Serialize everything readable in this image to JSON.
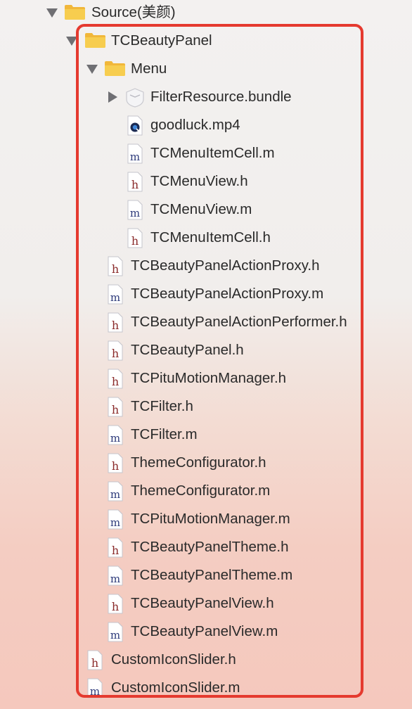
{
  "tree": {
    "root": {
      "label": "Source(美颜)",
      "icon": "folder-icon"
    },
    "panel": {
      "label": "TCBeautyPanel",
      "icon": "folder-icon"
    },
    "menu": {
      "label": "Menu",
      "icon": "folder-icon"
    },
    "menu_items": [
      {
        "label": "FilterResource.bundle",
        "icon": "bundle-icon",
        "kind": "bundle"
      },
      {
        "label": "goodluck.mp4",
        "icon": "quicktime-icon",
        "kind": "video"
      },
      {
        "label": "TCMenuItemCell.m",
        "icon": "m-file-icon",
        "kind": "m"
      },
      {
        "label": "TCMenuView.h",
        "icon": "h-file-icon",
        "kind": "h"
      },
      {
        "label": "TCMenuView.m",
        "icon": "m-file-icon",
        "kind": "m"
      },
      {
        "label": "TCMenuItemCell.h",
        "icon": "h-file-icon",
        "kind": "h"
      }
    ],
    "panel_items": [
      {
        "label": "TCBeautyPanelActionProxy.h",
        "kind": "h"
      },
      {
        "label": "TCBeautyPanelActionProxy.m",
        "kind": "m"
      },
      {
        "label": "TCBeautyPanelActionPerformer.h",
        "kind": "h"
      },
      {
        "label": "TCBeautyPanel.h",
        "kind": "h"
      },
      {
        "label": "TCPituMotionManager.h",
        "kind": "h"
      },
      {
        "label": "TCFilter.h",
        "kind": "h"
      },
      {
        "label": "TCFilter.m",
        "kind": "m"
      },
      {
        "label": "ThemeConfigurator.h",
        "kind": "h"
      },
      {
        "label": "ThemeConfigurator.m",
        "kind": "m"
      },
      {
        "label": "TCPituMotionManager.m",
        "kind": "m"
      },
      {
        "label": "TCBeautyPanelTheme.h",
        "kind": "h"
      },
      {
        "label": "TCBeautyPanelTheme.m",
        "kind": "m"
      },
      {
        "label": "TCBeautyPanelView.h",
        "kind": "h"
      },
      {
        "label": "TCBeautyPanelView.m",
        "kind": "m"
      }
    ],
    "source_items": [
      {
        "label": "CustomIconSlider.h",
        "kind": "h"
      },
      {
        "label": "CustomIconSlider.m",
        "kind": "m"
      }
    ]
  },
  "colors": {
    "folder": "#f5c343",
    "highlight_border": "#e53a2f",
    "h_letter": "#8a2a2a",
    "m_letter": "#2d3a7a"
  }
}
